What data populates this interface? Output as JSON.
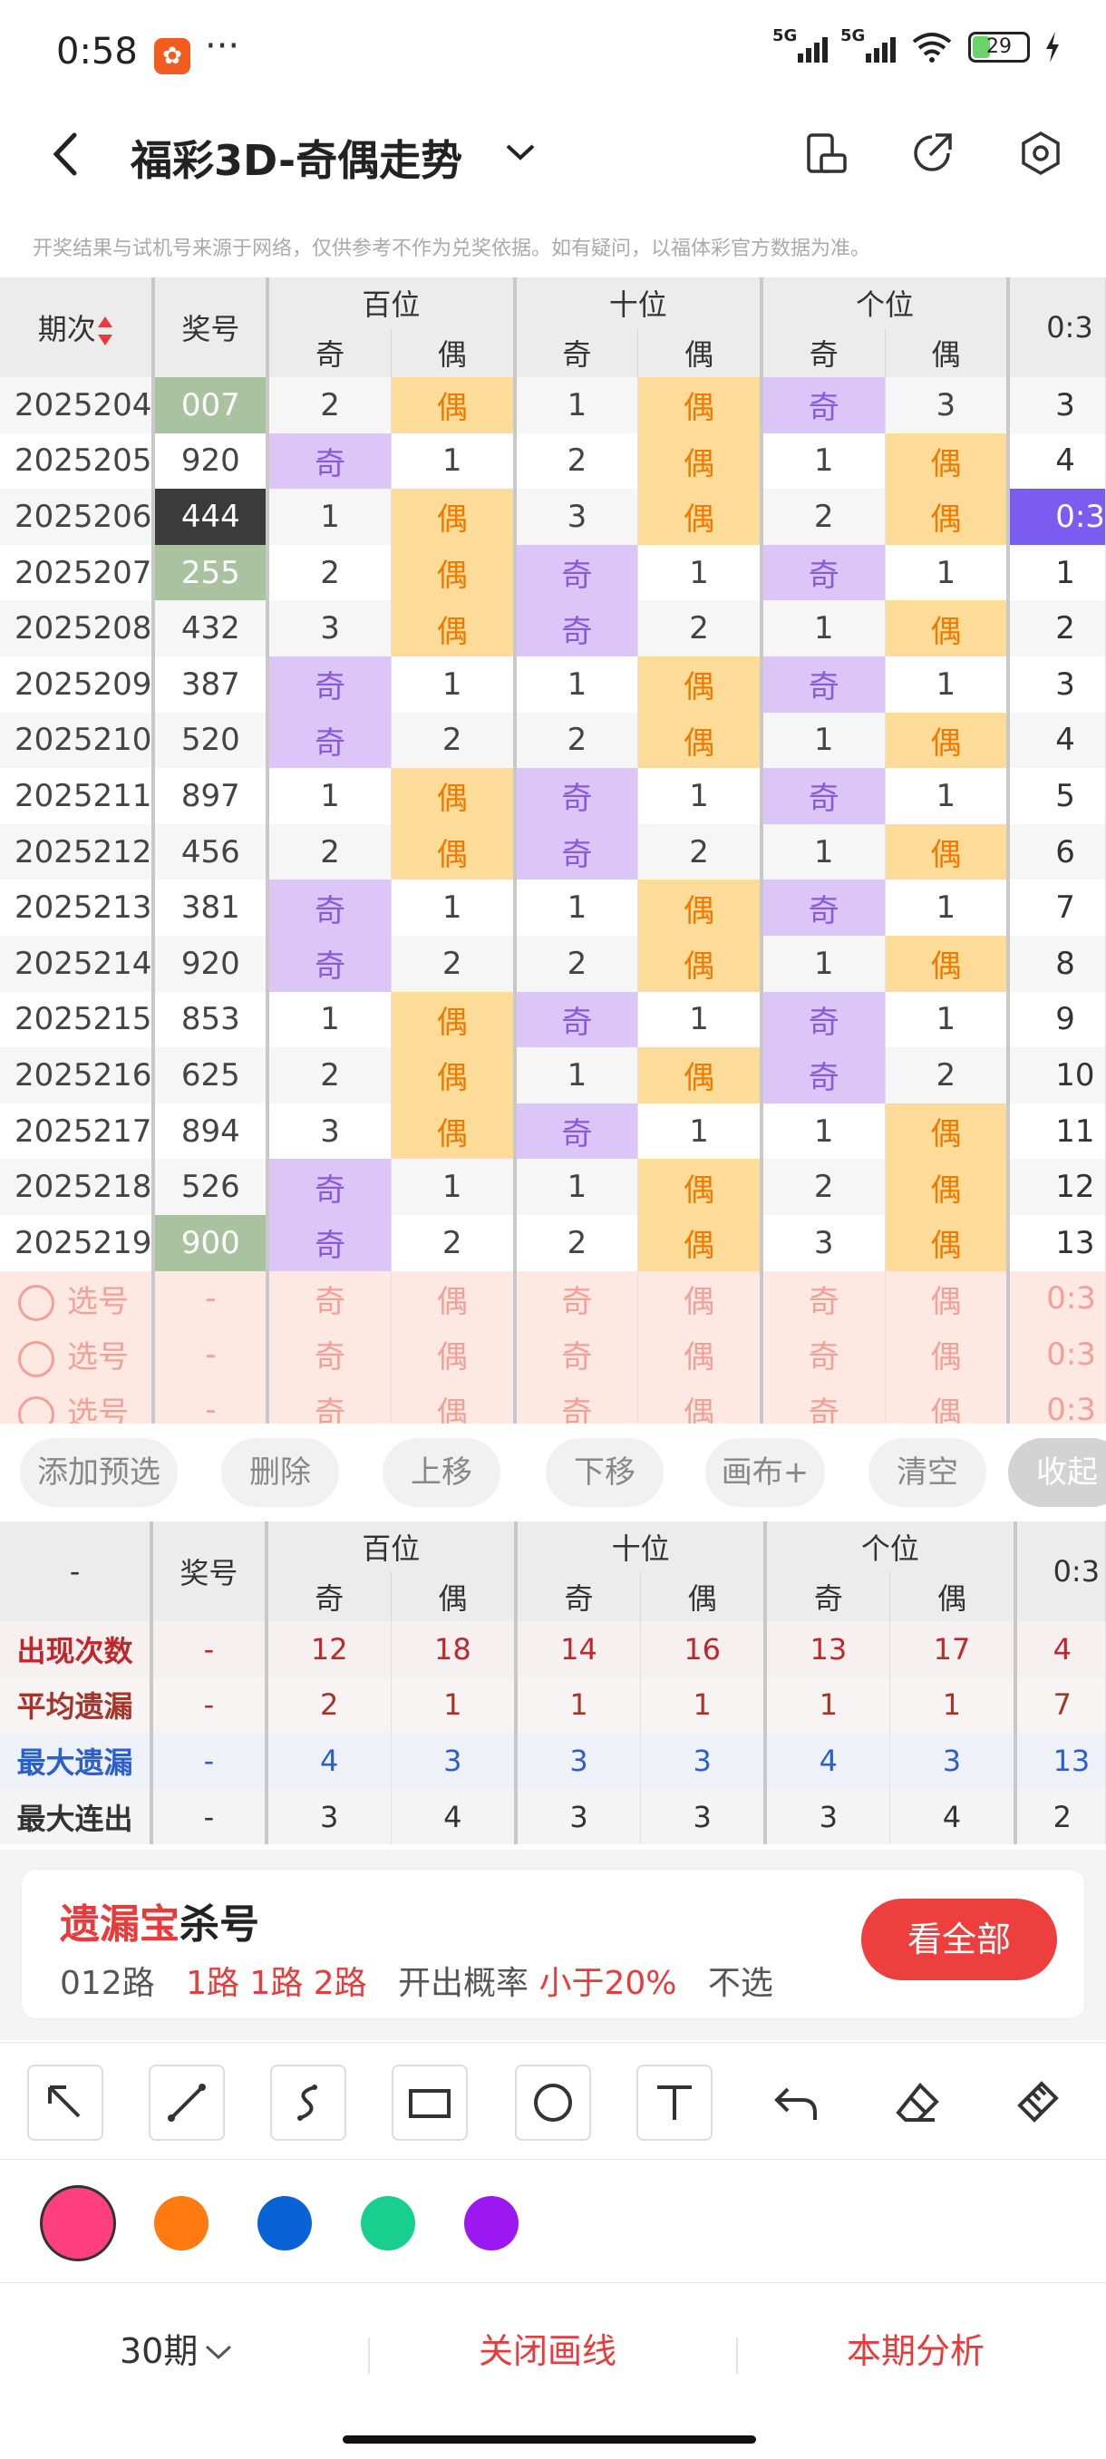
{
  "status": {
    "time": "0:58",
    "battery": "29",
    "net1": "5G",
    "net2": "5G",
    "more": "···"
  },
  "nav": {
    "title": "福彩3D-奇偶走势"
  },
  "disclaimer": "开奖结果与试机号来源于网络，仅供参考不作为兑奖依据。如有疑问，以福体彩官方数据为准。",
  "trend": {
    "head_period": "期次",
    "head_number": "奖号",
    "groups": [
      "百位",
      "十位",
      "个位"
    ],
    "sub": [
      "奇",
      "偶",
      "奇",
      "偶",
      "奇",
      "偶"
    ],
    "extra_head": "0:3",
    "rows": [
      {
        "issue": "2025204",
        "num": "007",
        "cells": [
          "2",
          "偶",
          "1",
          "偶",
          "奇",
          "3"
        ],
        "extra": "3"
      },
      {
        "issue": "2025205",
        "num": "920",
        "cells": [
          "奇",
          "1",
          "2",
          "偶",
          "1",
          "偶"
        ],
        "extra": "4"
      },
      {
        "issue": "2025206",
        "num": "444",
        "cells": [
          "1",
          "偶",
          "3",
          "偶",
          "2",
          "偶"
        ],
        "extra": "0:3"
      },
      {
        "issue": "2025207",
        "num": "255",
        "cells": [
          "2",
          "偶",
          "奇",
          "1",
          "奇",
          "1"
        ],
        "extra": "1"
      },
      {
        "issue": "2025208",
        "num": "432",
        "cells": [
          "3",
          "偶",
          "奇",
          "2",
          "1",
          "偶"
        ],
        "extra": "2"
      },
      {
        "issue": "2025209",
        "num": "387",
        "cells": [
          "奇",
          "1",
          "1",
          "偶",
          "奇",
          "1"
        ],
        "extra": "3"
      },
      {
        "issue": "2025210",
        "num": "520",
        "cells": [
          "奇",
          "2",
          "2",
          "偶",
          "1",
          "偶"
        ],
        "extra": "4"
      },
      {
        "issue": "2025211",
        "num": "897",
        "cells": [
          "1",
          "偶",
          "奇",
          "1",
          "奇",
          "1"
        ],
        "extra": "5"
      },
      {
        "issue": "2025212",
        "num": "456",
        "cells": [
          "2",
          "偶",
          "奇",
          "2",
          "1",
          "偶"
        ],
        "extra": "6"
      },
      {
        "issue": "2025213",
        "num": "381",
        "cells": [
          "奇",
          "1",
          "1",
          "偶",
          "奇",
          "1"
        ],
        "extra": "7"
      },
      {
        "issue": "2025214",
        "num": "920",
        "cells": [
          "奇",
          "2",
          "2",
          "偶",
          "1",
          "偶"
        ],
        "extra": "8"
      },
      {
        "issue": "2025215",
        "num": "853",
        "cells": [
          "1",
          "偶",
          "奇",
          "1",
          "奇",
          "1"
        ],
        "extra": "9"
      },
      {
        "issue": "2025216",
        "num": "625",
        "cells": [
          "2",
          "偶",
          "1",
          "偶",
          "奇",
          "2"
        ],
        "extra": "10"
      },
      {
        "issue": "2025217",
        "num": "894",
        "cells": [
          "3",
          "偶",
          "奇",
          "1",
          "1",
          "偶"
        ],
        "extra": "11"
      },
      {
        "issue": "2025218",
        "num": "526",
        "cells": [
          "奇",
          "1",
          "1",
          "偶",
          "2",
          "偶"
        ],
        "extra": "12"
      },
      {
        "issue": "2025219",
        "num": "900",
        "cells": [
          "奇",
          "2",
          "2",
          "偶",
          "3",
          "偶"
        ],
        "extra": "13"
      }
    ],
    "pick_label": "选号",
    "pick_dash": "-",
    "pick_cells": [
      "奇",
      "偶",
      "奇",
      "偶",
      "奇",
      "偶"
    ],
    "pick_extra": "0:3"
  },
  "actions": [
    "添加预选",
    "删除",
    "上移",
    "下移",
    "画布+",
    "清空",
    "收起"
  ],
  "stats": {
    "head_label": "-",
    "head_number": "奖号",
    "groups": [
      "百位",
      "十位",
      "个位"
    ],
    "sub": [
      "奇",
      "偶",
      "奇",
      "偶",
      "奇",
      "偶"
    ],
    "extra_head": "0:3",
    "rows": [
      {
        "label": "出现次数",
        "num": "-",
        "cells": [
          "12",
          "18",
          "14",
          "16",
          "13",
          "17"
        ],
        "extra": "4"
      },
      {
        "label": "平均遗漏",
        "num": "-",
        "cells": [
          "2",
          "1",
          "1",
          "1",
          "1",
          "1"
        ],
        "extra": "7"
      },
      {
        "label": "最大遗漏",
        "num": "-",
        "cells": [
          "4",
          "3",
          "3",
          "3",
          "4",
          "3"
        ],
        "extra": "13"
      },
      {
        "label": "最大连出",
        "num": "-",
        "cells": [
          "3",
          "4",
          "3",
          "3",
          "3",
          "4"
        ],
        "extra": "2"
      }
    ]
  },
  "promo": {
    "title_red": "遗漏宝",
    "title_rest": "杀号",
    "route": "012路",
    "routes_red": "1路 1路 2路",
    "prob_label": "开出概率",
    "prob_red": "小于20%",
    "no_pick": "不选",
    "button": "看全部"
  },
  "colors": [
    "#ff3f7f",
    "#ff7a10",
    "#0a63d6",
    "#19cf8f",
    "#9c18f0"
  ],
  "bottom": {
    "periods": "30期",
    "close": "关闭画线",
    "analysis": "本期分析"
  }
}
